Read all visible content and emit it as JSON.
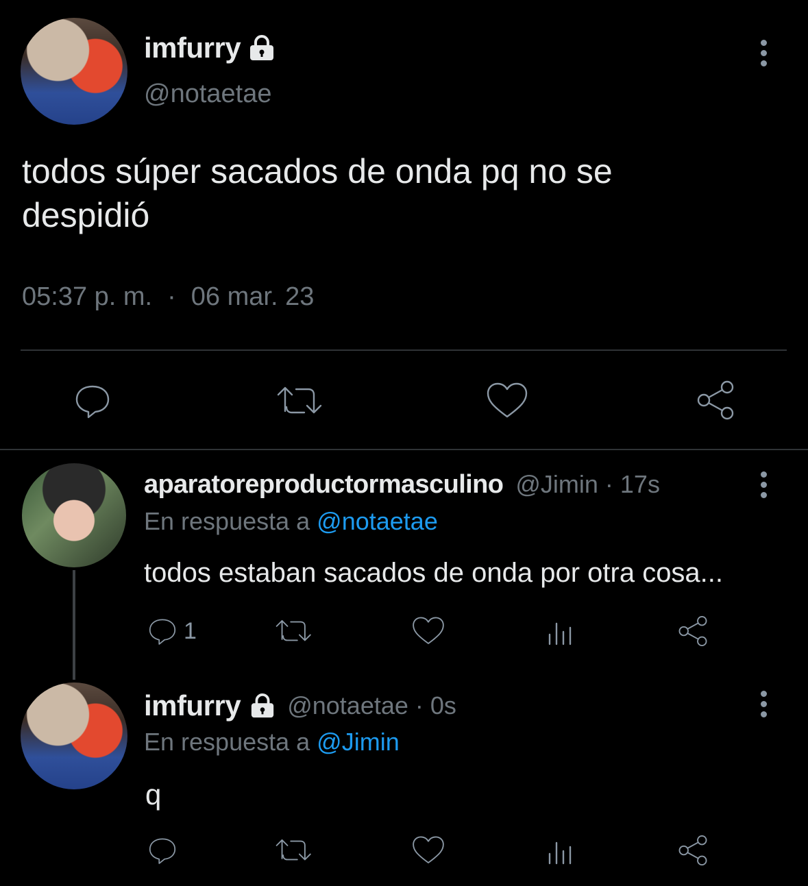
{
  "main_tweet": {
    "display_name": "imfurry",
    "handle": "@notaetae",
    "text_line1": "todos súper sacados de onda pq no se",
    "text_line2": "despidió",
    "time": "05:37 p. m.",
    "separator": "·",
    "date": "06 mar. 23"
  },
  "reply1": {
    "display_name": "aparatoreproductormasculino",
    "meta": "@Jimin · 17s",
    "reply_prefix": "En respuesta a",
    "reply_to": "@notaetae",
    "text": "todos estaban sacados de onda por otra cosa...",
    "reply_count": "1"
  },
  "reply2": {
    "display_name": "imfurry",
    "meta": "@notaetae · 0s",
    "reply_prefix": "En respuesta a",
    "reply_to": "@Jimin",
    "text": "q"
  },
  "icons": {
    "lock": "lock-icon",
    "reply": "reply-icon",
    "retweet": "retweet-icon",
    "like": "heart-icon",
    "share": "share-icon",
    "views": "views-icon",
    "more": "more-vertical-icon"
  },
  "colors": {
    "background": "#000000",
    "text": "#e7e9ea",
    "muted": "#6e767d",
    "link": "#1d9bf0",
    "icon": "#8b98a5"
  }
}
